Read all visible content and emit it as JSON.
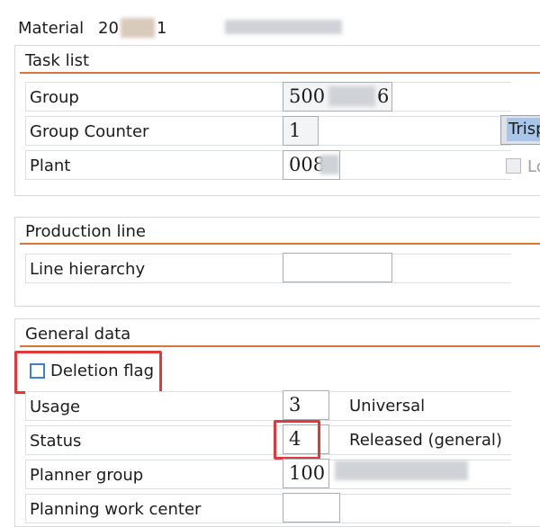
{
  "header": {
    "material_label": "Material",
    "material_prefix": "20",
    "material_suffix": "1"
  },
  "task_list": {
    "title": "Task list",
    "group": {
      "label": "Group",
      "value_start": "500",
      "value_end": "6"
    },
    "group_counter": {
      "label": "Group Counter",
      "value": "1"
    },
    "plant": {
      "label": "Plant",
      "value": "008"
    },
    "side_button_label": "Trisp",
    "side_checkbox_label": "Lo"
  },
  "production_line": {
    "title": "Production line",
    "line_hierarchy": {
      "label": "Line hierarchy",
      "value": ""
    }
  },
  "general_data": {
    "title": "General data",
    "deletion_flag": {
      "label": "Deletion flag",
      "checked": false
    },
    "usage": {
      "label": "Usage",
      "value": "3",
      "description": "Universal"
    },
    "status": {
      "label": "Status",
      "value": "4",
      "description": "Released (general)"
    },
    "planner_group": {
      "label": "Planner group",
      "value": "100"
    },
    "planning_work_center": {
      "label": "Planning work center",
      "value": ""
    }
  },
  "colors": {
    "highlight_red": "#e0393a",
    "section_line_orange": "#d9743a",
    "checkbox_blue": "#3e7fcf"
  }
}
